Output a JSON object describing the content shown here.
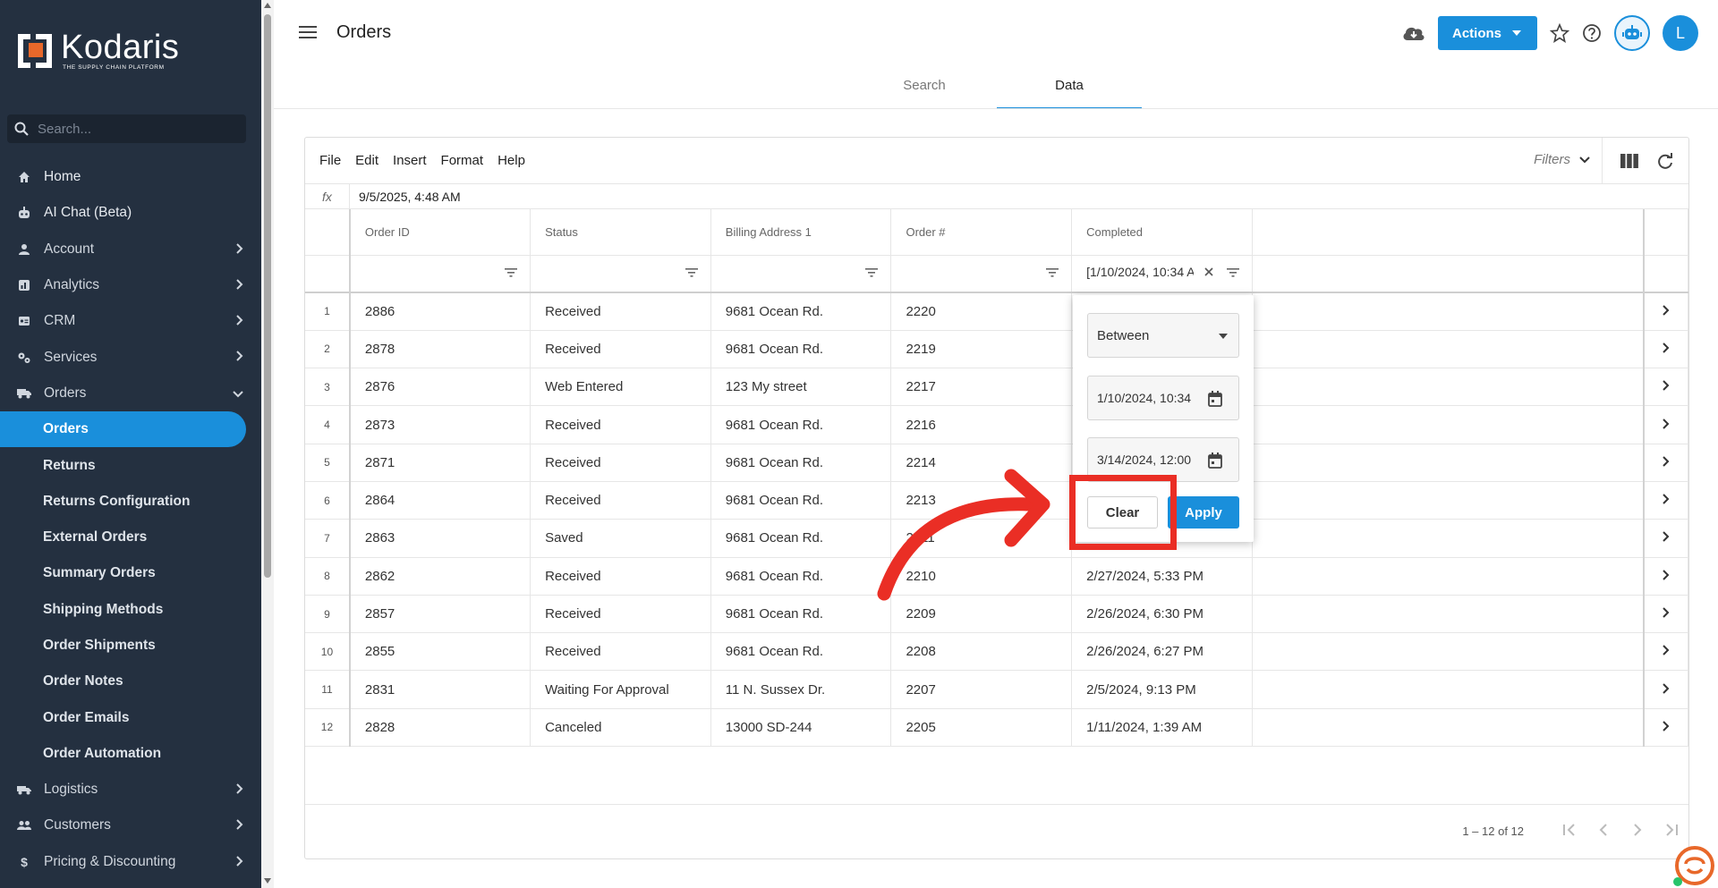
{
  "sidebar": {
    "logo_word": "Kodaris",
    "logo_tagline": "THE SUPPLY CHAIN PLATFORM",
    "search_placeholder": "Search...",
    "items": [
      {
        "label": "Home",
        "icon": "home-icon"
      },
      {
        "label": "AI Chat (Beta)",
        "icon": "robot-icon"
      },
      {
        "label": "Account",
        "icon": "person-icon",
        "chevron": "right"
      },
      {
        "label": "Analytics",
        "icon": "analytics-icon",
        "chevron": "right"
      },
      {
        "label": "CRM",
        "icon": "crm-icon",
        "chevron": "right"
      },
      {
        "label": "Services",
        "icon": "services-icon",
        "chevron": "right"
      },
      {
        "label": "Orders",
        "icon": "truck-icon",
        "chevron": "down"
      }
    ],
    "orders_sub": [
      "Orders",
      "Returns",
      "Returns Configuration",
      "External Orders",
      "Summary Orders",
      "Shipping Methods",
      "Order Shipments",
      "Order Notes",
      "Order Emails",
      "Order Automation"
    ],
    "bottom_items": [
      {
        "label": "Logistics",
        "icon": "logistics-icon"
      },
      {
        "label": "Customers",
        "icon": "customers-icon"
      },
      {
        "label": "Pricing & Discounting",
        "icon": "dollar-icon"
      }
    ]
  },
  "header": {
    "title": "Orders",
    "actions_label": "Actions",
    "avatar_letter": "L",
    "tabs": [
      "Search",
      "Data"
    ],
    "active_tab": "Data"
  },
  "grid": {
    "menu": [
      "File",
      "Edit",
      "Insert",
      "Format",
      "Help"
    ],
    "filters_label": "Filters",
    "fx_label": "fx",
    "fx_value": "9/5/2025, 4:48 AM",
    "columns": [
      "Order ID",
      "Status",
      "Billing Address 1",
      "Order #",
      "Completed"
    ],
    "completed_filter": "[1/10/2024, 10:34 AM",
    "rows": [
      {
        "n": "1",
        "id": "2886",
        "status": "Received",
        "addr": "9681 Ocean Rd.",
        "order": "2220",
        "completed": ""
      },
      {
        "n": "2",
        "id": "2878",
        "status": "Received",
        "addr": "9681 Ocean Rd.",
        "order": "2219",
        "completed": ""
      },
      {
        "n": "3",
        "id": "2876",
        "status": "Web Entered",
        "addr": "123 My street",
        "order": "2217",
        "completed": ""
      },
      {
        "n": "4",
        "id": "2873",
        "status": "Received",
        "addr": "9681 Ocean Rd.",
        "order": "2216",
        "completed": ""
      },
      {
        "n": "5",
        "id": "2871",
        "status": "Received",
        "addr": "9681 Ocean Rd.",
        "order": "2214",
        "completed": ""
      },
      {
        "n": "6",
        "id": "2864",
        "status": "Received",
        "addr": "9681 Ocean Rd.",
        "order": "2213",
        "completed": ""
      },
      {
        "n": "7",
        "id": "2863",
        "status": "Saved",
        "addr": "9681 Ocean Rd.",
        "order": "2211",
        "completed": ""
      },
      {
        "n": "8",
        "id": "2862",
        "status": "Received",
        "addr": "9681 Ocean Rd.",
        "order": "2210",
        "completed": "2/27/2024, 5:33 PM"
      },
      {
        "n": "9",
        "id": "2857",
        "status": "Received",
        "addr": "9681 Ocean Rd.",
        "order": "2209",
        "completed": "2/26/2024, 6:30 PM"
      },
      {
        "n": "10",
        "id": "2855",
        "status": "Received",
        "addr": "9681 Ocean Rd.",
        "order": "2208",
        "completed": "2/26/2024, 6:27 PM"
      },
      {
        "n": "11",
        "id": "2831",
        "status": "Waiting For Approval",
        "addr": "11 N. Sussex Dr.",
        "order": "2207",
        "completed": "2/5/2024, 9:13 PM"
      },
      {
        "n": "12",
        "id": "2828",
        "status": "Canceled",
        "addr": "13000 SD-244",
        "order": "2205",
        "completed": "1/11/2024, 1:39 AM"
      }
    ],
    "paging": "1 – 12 of 12"
  },
  "filter_popup": {
    "operator": "Between",
    "from": "1/10/2024, 10:34",
    "to": "3/14/2024, 12:00",
    "clear_label": "Clear",
    "apply_label": "Apply"
  },
  "colors": {
    "accent": "#1a8fdb",
    "sidebar": "#243040",
    "annotation": "#ea2e25"
  }
}
